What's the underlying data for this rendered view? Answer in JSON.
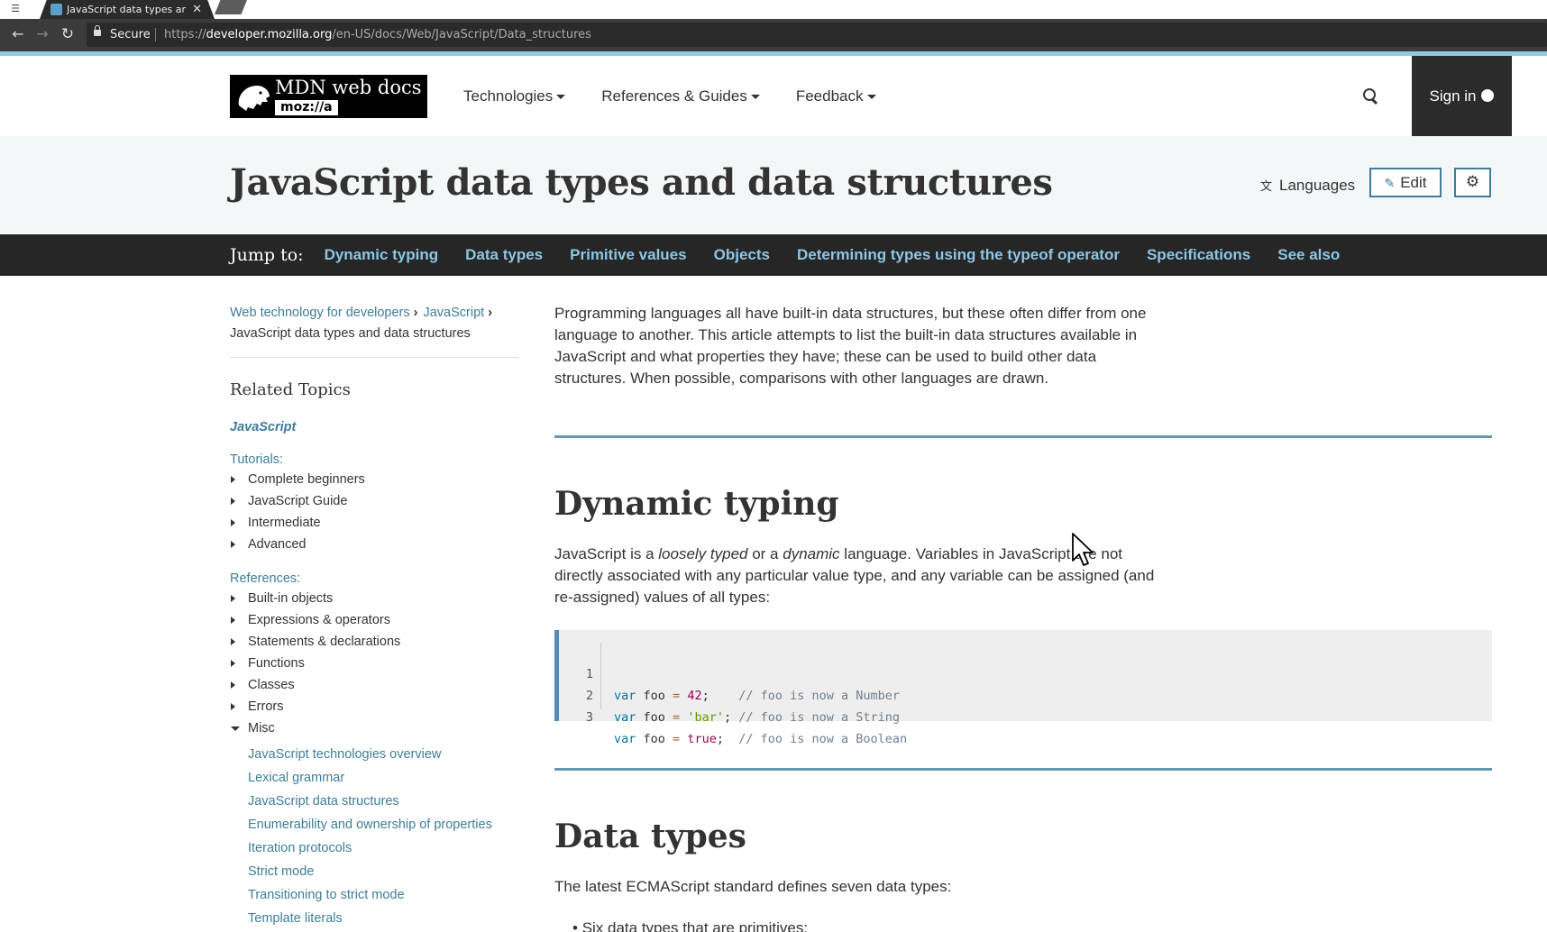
{
  "browser": {
    "tab_title": "JavaScript data types and",
    "secure_label": "Secure",
    "url_scheme": "https://",
    "url_host": "developer.mozilla.org",
    "url_path": "/en-US/docs/Web/JavaScript/Data_structures"
  },
  "header": {
    "logo_text": "MDN web docs",
    "logo_sub": "moz://a",
    "nav": [
      {
        "label": "Technologies"
      },
      {
        "label": "References & Guides"
      },
      {
        "label": "Feedback"
      }
    ],
    "signin_label": "Sign in"
  },
  "title_band": {
    "title": "JavaScript data types and data structures",
    "languages_label": "Languages",
    "edit_label": "Edit"
  },
  "jump_bar": {
    "label": "Jump to:",
    "links": [
      "Dynamic typing",
      "Data types",
      "Primitive values",
      "Objects",
      "Determining types using the typeof operator",
      "Specifications",
      "See also"
    ]
  },
  "sidebar": {
    "breadcrumbs": [
      "Web technology for developers",
      "JavaScript",
      "JavaScript data types and data structures"
    ],
    "related_title": "Related Topics",
    "js_link": "JavaScript",
    "tutorials_label": "Tutorials:",
    "tutorials": [
      "Complete beginners",
      "JavaScript Guide",
      "Intermediate",
      "Advanced"
    ],
    "references_label": "References:",
    "references": [
      "Built-in objects",
      "Expressions & operators",
      "Statements & declarations",
      "Functions",
      "Classes",
      "Errors",
      "Misc"
    ],
    "misc_items": [
      "JavaScript technologies overview",
      "Lexical grammar",
      "JavaScript data structures",
      "Enumerability and ownership of properties",
      "Iteration protocols",
      "Strict mode",
      "Transitioning to strict mode",
      "Template literals"
    ]
  },
  "content": {
    "intro": "Programming languages all have built-in data structures, but these often differ from one language to another. This article attempts to list the built-in data structures available in JavaScript and what properties they have; these can be used to build other data structures. When possible, comparisons with other languages are drawn.",
    "h_dynamic": "Dynamic typing",
    "dyn_p1": "JavaScript is a ",
    "dyn_em1": "loosely typed",
    "dyn_p2": " or a ",
    "dyn_em2": "dynamic",
    "dyn_p3": " language. Variables in JavaScript are not directly associated with any particular value type, and any variable can be assigned (and re-assigned)  values of all types:",
    "code": [
      {
        "ln": "1",
        "kw": "var",
        "name": " foo ",
        "op": "=",
        "val": "42",
        "val_type": "num",
        "rest": ";    ",
        "comment": "// foo is now a Number"
      },
      {
        "ln": "2",
        "kw": "var",
        "name": " foo ",
        "op": "=",
        "val": "'bar'",
        "val_type": "str",
        "rest": "; ",
        "comment": "// foo is now a String"
      },
      {
        "ln": "3",
        "kw": "var",
        "name": " foo ",
        "op": "=",
        "val": "true",
        "val_type": "num",
        "rest": ";  ",
        "comment": "// foo is now a Boolean"
      }
    ],
    "h_datatypes": "Data types",
    "dt_p": "The latest ECMAScript standard defines seven data types:",
    "dt_bullet": "Six data types that are primitives:"
  },
  "colors": {
    "link": "#3d7e9a",
    "jump_link": "#8cc6e4",
    "header_dark": "#262626",
    "title_band": "#f4f7f8"
  }
}
